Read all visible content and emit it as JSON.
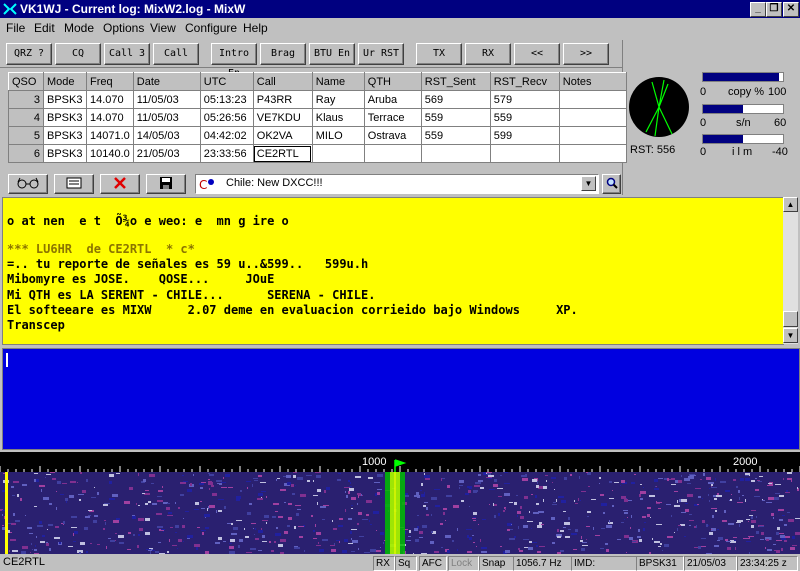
{
  "window": {
    "title": "VK1WJ - Current log: MixW2.log - MixW",
    "min_glyph": "_",
    "max_glyph": "❐",
    "close_glyph": "✕"
  },
  "menu": [
    "File",
    "Edit",
    "Mode",
    "Options",
    "View",
    "Configure",
    "Help"
  ],
  "macros": [
    "QRZ ?",
    "CQ",
    "Call 3",
    "Call",
    "Intro En",
    "Brag",
    "BTU En",
    "Ur RST",
    "TX",
    "RX",
    "<<",
    ">>"
  ],
  "log": {
    "headers": [
      "QSO",
      "Mode",
      "Freq",
      "Date",
      "UTC",
      "Call",
      "Name",
      "QTH",
      "RST_Sent",
      "RST_Recv",
      "Notes"
    ],
    "rows": [
      [
        "3",
        "BPSK3",
        "14.070",
        "11/05/03",
        "05:13:23",
        "P43RR",
        "Ray",
        "Aruba",
        "569",
        "579",
        ""
      ],
      [
        "4",
        "BPSK3",
        "14.070",
        "11/05/03",
        "05:26:56",
        "VE7KDU",
        "Klaus",
        "Terrace",
        "559",
        "559",
        ""
      ],
      [
        "5",
        "BPSK3",
        "14071.0",
        "14/05/03",
        "04:42:02",
        "OK2VA",
        "MILO",
        "Ostrava",
        "559",
        "599",
        ""
      ],
      [
        "6",
        "BPSK3",
        "10140.0",
        "21/05/03",
        "23:33:56",
        "CE2RTL",
        "",
        "",
        "",
        "",
        ""
      ]
    ]
  },
  "tools": {
    "dxcc_text": "Chile:  New DXCC!!!"
  },
  "meters": {
    "copy": {
      "label": "copy %",
      "min": "0",
      "max": "100",
      "fill": 0.95
    },
    "sn": {
      "label": "s/n",
      "min": "0",
      "max": "60",
      "fill": 0.5
    },
    "imd": {
      "label": "i l m",
      "min": "0",
      "max": "-40",
      "fill": 0.5
    },
    "rst_label": "RST: 556"
  },
  "terminal": {
    "lines": [
      "o at nen  e t  Õ¾o e weo: e  mn g ire o",
      "",
      "*** LU6HR  de CE2RTL  * c*",
      "=.. tu reporte de señales es 59 u..&599..   599u.h",
      "Mibomyre es JOSE.    QOSE...     JOuE",
      "Mi QTH es LA SERENT - CHILE...      SERENA - CHILE.",
      "El softeeare es MIXW     2.07 deme en evaluacion corrieido bajo Windows     XP.",
      "Transcep"
    ]
  },
  "waterfall": {
    "scale_labels": [
      "1000",
      "2000"
    ]
  },
  "status": {
    "call": "CE2RTL",
    "cells": [
      "RX",
      "Sq",
      "AFC",
      "Lock",
      "Snap",
      "1056.7 Hz",
      "IMD:",
      "",
      "BPSK31",
      "21/05/03",
      "23:34:25 z"
    ]
  },
  "colors": {
    "terminal_bg": "#ffff00",
    "tx_bg": "#0000e0",
    "title_bg": "#000080"
  }
}
